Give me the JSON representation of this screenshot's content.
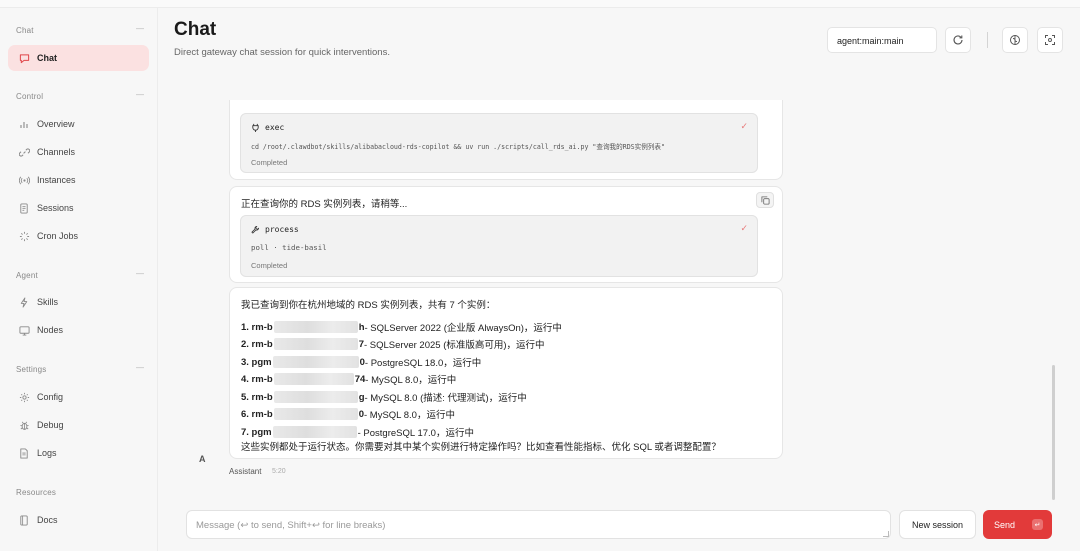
{
  "sidebar": {
    "groups": [
      {
        "title": "Chat",
        "items": [
          {
            "label": "Chat",
            "icon": "chat-bubble-icon",
            "active": true
          }
        ]
      },
      {
        "title": "Control",
        "items": [
          {
            "label": "Overview",
            "icon": "bar-chart-icon"
          },
          {
            "label": "Channels",
            "icon": "link-icon"
          },
          {
            "label": "Instances",
            "icon": "radio-icon"
          },
          {
            "label": "Sessions",
            "icon": "document-icon"
          },
          {
            "label": "Cron Jobs",
            "icon": "loader-icon"
          }
        ]
      },
      {
        "title": "Agent",
        "items": [
          {
            "label": "Skills",
            "icon": "bolt-icon"
          },
          {
            "label": "Nodes",
            "icon": "monitor-icon"
          }
        ]
      },
      {
        "title": "Settings",
        "items": [
          {
            "label": "Config",
            "icon": "gear-icon"
          },
          {
            "label": "Debug",
            "icon": "bug-icon"
          },
          {
            "label": "Logs",
            "icon": "file-text-icon"
          }
        ]
      },
      {
        "title": "Resources",
        "items": [
          {
            "label": "Docs",
            "icon": "book-icon"
          }
        ]
      }
    ]
  },
  "header": {
    "title": "Chat",
    "subtitle": "Direct gateway chat session for quick interventions.",
    "agent": "agent:main:main"
  },
  "messages": {
    "exec": {
      "tool": "exec",
      "command": "cd /root/.clawdbot/skills/alibabacloud-rds-copilot && uv run ./scripts/call_rds_ai.py \"查询我的RDS实例列表\"",
      "status": "Completed"
    },
    "process_msg": {
      "text": "正在查询你的 RDS 实例列表，请稍等...",
      "tool": "process",
      "detail": "poll · tide-basil",
      "status": "Completed"
    },
    "answer": {
      "intro": "我已查询到你在杭州地域的 RDS 实例列表，共有 7 个实例：",
      "instances": [
        {
          "prefix": "1. rm-b",
          "suffix": "h",
          "desc": " - SQLServer 2022 (企业版 AlwaysOn)，运行中"
        },
        {
          "prefix": "2. rm-b",
          "suffix": "7",
          "desc": " - SQLServer 2025 (标准版高可用)，运行中"
        },
        {
          "prefix": "3. pgm",
          "suffix": "0",
          "desc": " - PostgreSQL 18.0，运行中"
        },
        {
          "prefix": "4. rm-b",
          "suffix": "74",
          "desc": " - MySQL 8.0，运行中"
        },
        {
          "prefix": "5. rm-b",
          "suffix": "g",
          "desc": " - MySQL 8.0 (描述: 代理测试)，运行中"
        },
        {
          "prefix": "6. rm-b",
          "suffix": "0",
          "desc": " - MySQL 8.0，运行中"
        },
        {
          "prefix": "7. pgm",
          "suffix": "",
          "desc": " - PostgreSQL 17.0，运行中"
        }
      ],
      "outro": "这些实例都处于运行状态。你需要对其中某个实例进行特定操作吗？比如查看性能指标、优化 SQL 或者调整配置？",
      "avatar": "A",
      "sender": "Assistant",
      "time": "5:20"
    }
  },
  "composer": {
    "placeholder": "Message (↩ to send, Shift+↩ for line breaks)",
    "new_session": "New session",
    "send": "Send"
  },
  "colors": {
    "accent": "#e23a3a",
    "active_bg": "#fbe1e1"
  }
}
